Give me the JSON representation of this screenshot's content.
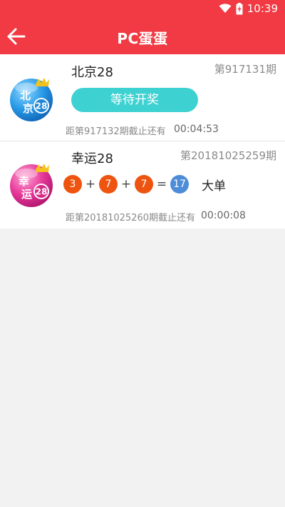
{
  "status_bar": {
    "time": "10:39",
    "icons": [
      "wifi-icon",
      "battery-charging-icon"
    ]
  },
  "app_bar": {
    "title": "PC蛋蛋",
    "back_icon": "arrow-left-icon"
  },
  "colors": {
    "primary": "#f13a43",
    "teal": "#3ed1d1",
    "ball_orange": "#ee5410",
    "ball_blue": "#4d8cd8"
  },
  "lotteries": [
    {
      "name": "北京28",
      "issue": "第917131期",
      "logo_text": [
        "北",
        "京"
      ],
      "logo_number": "28",
      "status_button": "等待开奖",
      "deadline_text": "距第917132期截止还有",
      "countdown": "00:04:53"
    },
    {
      "name": "幸运28",
      "issue": "第20181025259期",
      "logo_text": [
        "幸",
        "运"
      ],
      "logo_number": "28",
      "balls": [
        "3",
        "7",
        "7"
      ],
      "operators": [
        "+",
        "+",
        "="
      ],
      "sum": "17",
      "result": "大单",
      "deadline_text": "距第20181025260期截止还有",
      "countdown": "00:00:08"
    }
  ]
}
